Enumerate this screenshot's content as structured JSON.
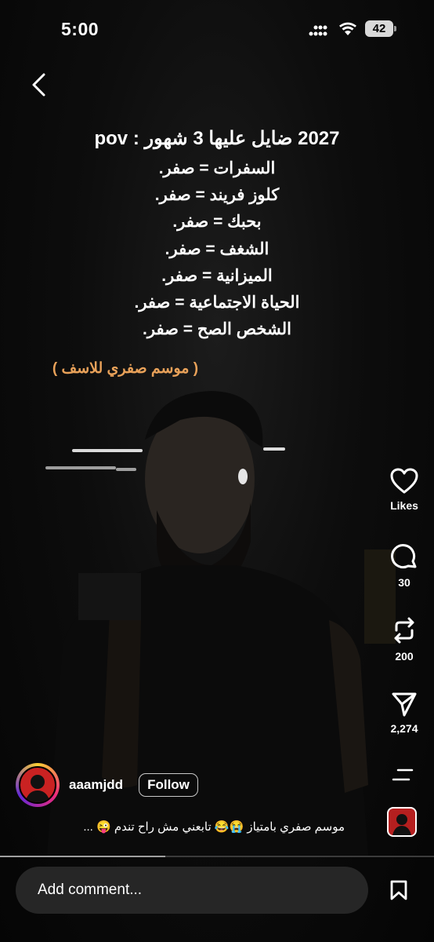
{
  "status_bar": {
    "time": "5:00",
    "battery": "42"
  },
  "overlay": {
    "title": "2027 ضايل عليها 3 شهور : pov",
    "lines": [
      "السفرات = صفر.",
      "كلوز فريند = صفر.",
      "بحبك = صفر.",
      "الشغف = صفر.",
      "الميزانية = صفر.",
      "الحياة الاجتماعية = صفر.",
      "الشخص الصح = صفر."
    ],
    "note": "( موسم صفري للاسف )",
    "note_color": "#e8a159"
  },
  "actions": {
    "likes_label": "Likes",
    "comments_count": "30",
    "reposts_count": "200",
    "shares_count": "2,274"
  },
  "author": {
    "username": "aaamjdd",
    "follow_label": "Follow"
  },
  "caption": "موسم صفري بامتياز 😭😂 تابعني مش راح تندم 😜 ...",
  "playback": {
    "progress_fraction": 0.38
  },
  "comment": {
    "placeholder": "Add comment..."
  },
  "icons": {
    "back": "chevron-left-icon",
    "like": "heart-icon",
    "comment": "comment-bubble-icon",
    "repost": "repost-icon",
    "share": "send-icon",
    "more": "more-lines-icon",
    "save": "bookmark-icon"
  },
  "colors": {
    "background": "#000000",
    "follow_border": "#c9c9c9",
    "comment_box": "#262626"
  }
}
